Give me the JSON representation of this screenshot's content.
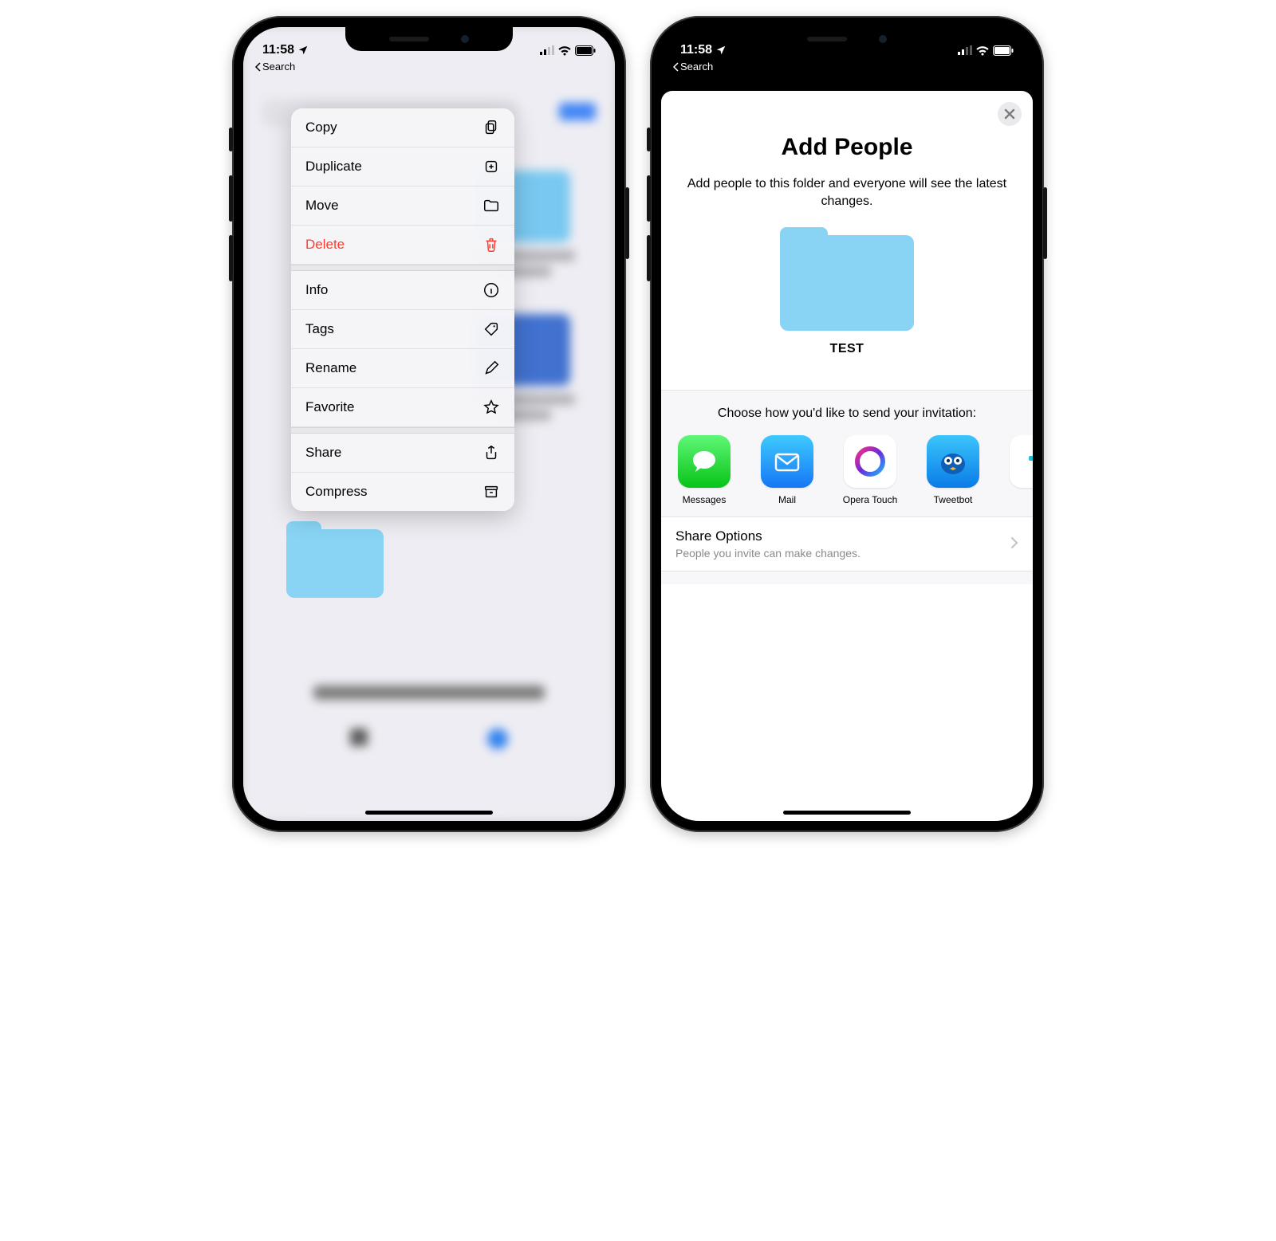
{
  "status": {
    "time": "11:58",
    "back_label": "Search"
  },
  "left": {
    "menu": {
      "copy": "Copy",
      "duplicate": "Duplicate",
      "move": "Move",
      "delete": "Delete",
      "info": "Info",
      "tags": "Tags",
      "rename": "Rename",
      "favorite": "Favorite",
      "share": "Share",
      "compress": "Compress"
    }
  },
  "right": {
    "sheet": {
      "title": "Add People",
      "subtitle": "Add people to this folder and everyone will see the latest changes.",
      "folder_name": "TEST",
      "choose_caption": "Choose how you'd like to send your invitation:",
      "apps": {
        "messages": "Messages",
        "mail": "Mail",
        "opera": "Opera Touch",
        "tweetbot": "Tweetbot"
      },
      "options_title": "Share Options",
      "options_sub": "People you invite can make changes."
    }
  }
}
